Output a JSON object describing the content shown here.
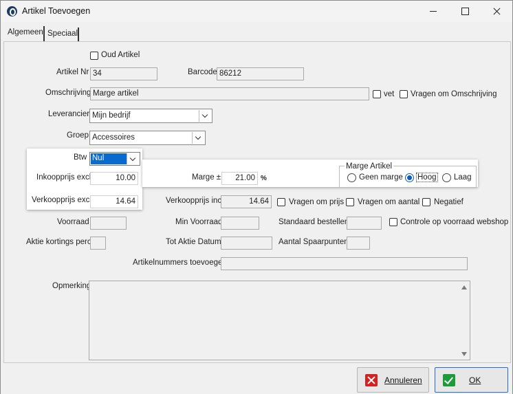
{
  "window": {
    "title": "Artikel Toevoegen",
    "minimize_label": "",
    "maximize_label": "",
    "close_label": ""
  },
  "tabs": [
    {
      "label": "Algemeen"
    },
    {
      "label": "Speciaal"
    }
  ],
  "form": {
    "oud_artikel": {
      "label": "Oud Artikel",
      "checked": false
    },
    "artikel_nr": {
      "label": "Artikel Nr",
      "value": "34"
    },
    "barcode": {
      "label": "Barcode",
      "value": "86212"
    },
    "omschrijving": {
      "label": "Omschrijving",
      "value": "Marge artikel"
    },
    "vet": {
      "label": "vet",
      "checked": false
    },
    "vragen_om_omschrijving": {
      "label": "Vragen om Omschrijving",
      "checked": false
    },
    "leverancier": {
      "label": "Leverancier",
      "value": "Mijn bedrijf"
    },
    "groep": {
      "label": "Groep",
      "value": "Accessoires"
    },
    "btw": {
      "label": "Btw",
      "value": "Nul"
    },
    "inkoopprijs": {
      "label": "Inkoopprijs excl",
      "value": "10.00"
    },
    "marge": {
      "label": "Marge ±",
      "value": "21.00",
      "unit": "%"
    },
    "marge_artikel": {
      "title": "Marge Artikel",
      "options": [
        {
          "label": "Geen marge",
          "selected": false
        },
        {
          "label": "Hoog",
          "selected": true
        },
        {
          "label": "Laag",
          "selected": false
        }
      ]
    },
    "verkoopprijs_excl": {
      "label": "Verkoopprijs excl",
      "value": "14.64"
    },
    "verkoopprijs_incl": {
      "label": "Verkoopprijs incl",
      "value": "14.64"
    },
    "vragen_om_prijs": {
      "label": "Vragen om prijs",
      "checked": false
    },
    "vragen_om_aantal": {
      "label": "Vragen om aantal",
      "checked": false
    },
    "negatief": {
      "label": "Negatief",
      "checked": false
    },
    "voorraad": {
      "label": "Voorraad",
      "value": ""
    },
    "min_voorraad": {
      "label": "Min Voorraad",
      "value": ""
    },
    "standaard_bestellen": {
      "label": "Standaard bestellen",
      "value": ""
    },
    "controle_voorraad_webshop": {
      "label": "Controle op voorraad webshop",
      "checked": false
    },
    "aktie_kortings_perc": {
      "label": "Aktie kortings perc",
      "value": ""
    },
    "tot_aktie_datum": {
      "label": "Tot Aktie Datum",
      "value": ""
    },
    "aantal_spaarpunten": {
      "label": "Aantal Spaarpunten",
      "value": ""
    },
    "artikelnummers_toevoegen": {
      "label": "Artikelnummers toevoegen",
      "value": ""
    },
    "opmerking": {
      "label": "Opmerking",
      "value": ""
    }
  },
  "buttons": {
    "annuleren": "Annuleren",
    "ok": "OK"
  },
  "colors": {
    "selection": "#0a6bcf",
    "cancel_icon": "#d42222",
    "ok_icon": "#1f9a3a",
    "ok_border": "#1e6fd0"
  }
}
